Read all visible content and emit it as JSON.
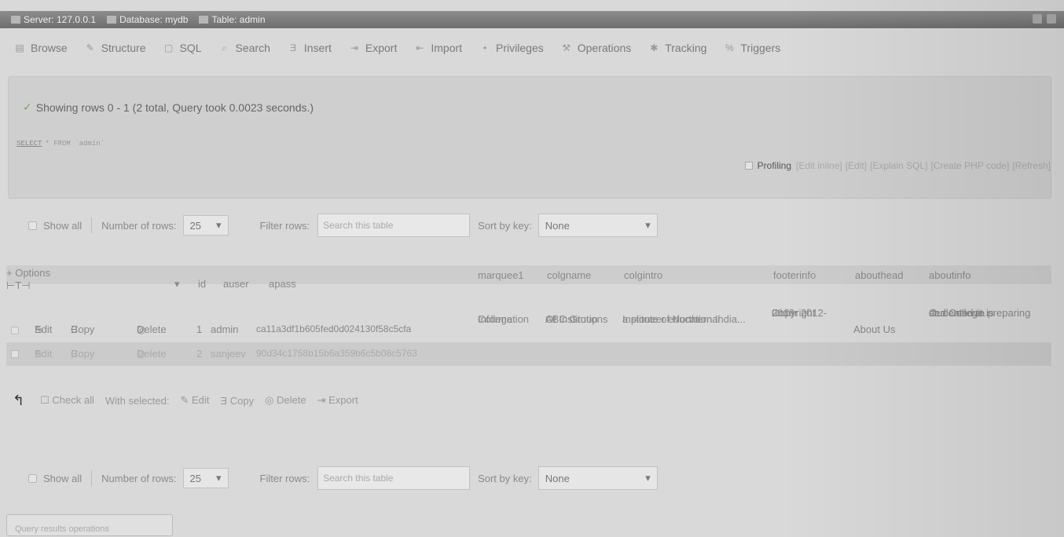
{
  "breadcrumb": [
    "Server: 127.0.0.1",
    "Database: mydb",
    "Table: admin"
  ],
  "tabs": [
    "Browse",
    "Structure",
    "SQL",
    "Search",
    "Insert",
    "Export",
    "Import",
    "Privileges",
    "Operations",
    "Tracking",
    "Triggers"
  ],
  "message": "Showing rows 0 - 1 (2 total, Query took 0.0023 seconds.)",
  "sql": {
    "keyword": "SELECT",
    "rest": "* FROM `admin`"
  },
  "profiling": {
    "label": "Profiling",
    "links": [
      "[Edit inline]",
      "[Edit]",
      "[Explain SQL]",
      "[Create PHP code]",
      "[Refresh]"
    ]
  },
  "nav": {
    "show_all": "Show all",
    "number_of_rows_label": "Number of rows:",
    "number_of_rows_value": "25",
    "filter_label": "Filter rows:",
    "filter_placeholder": "Search this table",
    "sort_label": "Sort by key:",
    "sort_value": "None"
  },
  "grid": {
    "options": "+ Options",
    "columns": [
      "id",
      "auser",
      "apass",
      "marquee1",
      "colgname",
      "colgintro",
      "footerinfo",
      "abouthead",
      "aboutinfo"
    ],
    "actions": {
      "edit": "Edit",
      "copy": "Copy",
      "delete": "Delete"
    },
    "rows": [
      {
        "id": "1",
        "auser": "admin",
        "apass": "ca11a3df1b605fed0d024130f58c5cfa",
        "marquee1": [
          "College",
          "Information"
        ],
        "colgname": [
          "ABC Group",
          "Of Institutions"
        ],
        "colgintro": [
          "a pioneer educational",
          "Institute of Northern India..."
        ],
        "footerinfo": [
          "Copyright",
          "under 2012-",
          "2013"
        ],
        "abouthead": "About Us",
        "aboutinfo": [
          "Our College is",
          "dedicated to preparing",
          "students wit..."
        ]
      },
      {
        "id": "2",
        "auser": "sanjeev",
        "apass": "90d34c1758b15b6a359b6c5b08c5763"
      }
    ]
  },
  "bulk": {
    "check_all": "Check all",
    "with_selected": "With selected:",
    "edit": "Edit",
    "copy": "Copy",
    "delete": "Delete",
    "export": "Export"
  },
  "bottom_box": "Query results operations"
}
